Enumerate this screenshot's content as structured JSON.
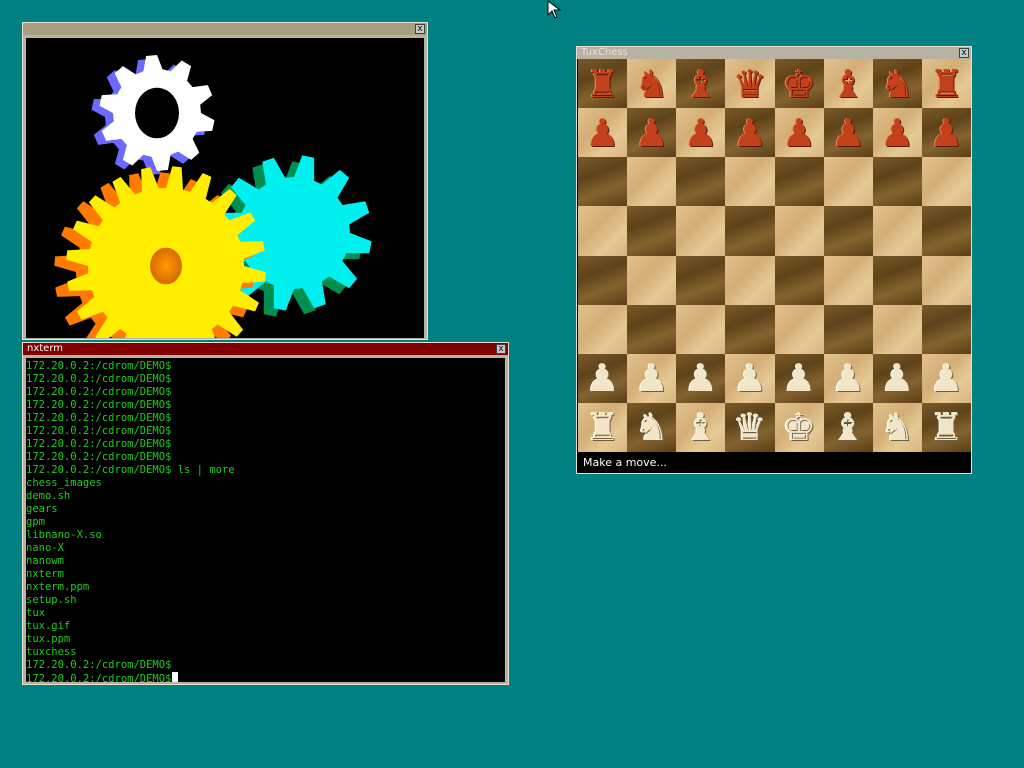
{
  "desktop": {
    "background_color": "#008080"
  },
  "windows": {
    "gears": {
      "title": "",
      "close_label": "x"
    },
    "terminal": {
      "title": "nxterm",
      "close_label": "x",
      "lines": [
        "172.20.0.2:/cdrom/DEMO$",
        "172.20.0.2:/cdrom/DEMO$",
        "172.20.0.2:/cdrom/DEMO$",
        "172.20.0.2:/cdrom/DEMO$",
        "172.20.0.2:/cdrom/DEMO$",
        "172.20.0.2:/cdrom/DEMO$",
        "172.20.0.2:/cdrom/DEMO$",
        "172.20.0.2:/cdrom/DEMO$",
        "172.20.0.2:/cdrom/DEMO$ ls | more",
        "chess_images",
        "demo.sh",
        "gears",
        "gpm",
        "libnano-X.so",
        "nano-X",
        "nanowm",
        "nxterm",
        "nxterm.ppm",
        "setup.sh",
        "tux",
        "tux.gif",
        "tux.ppm",
        "tuxchess",
        "172.20.0.2:/cdrom/DEMO$",
        "172.20.0.2:/cdrom/DEMO$"
      ],
      "text_color": "#1ccf1c"
    },
    "chess": {
      "title": "TuxChess",
      "close_label": "x",
      "status": "Make a move...",
      "board": [
        [
          "rook",
          "knight",
          "bishop",
          "queen",
          "king",
          "bishop",
          "knight",
          "rook"
        ],
        [
          "pawn",
          "pawn",
          "pawn",
          "pawn",
          "pawn",
          "pawn",
          "pawn",
          "pawn"
        ],
        [
          "",
          "",
          "",
          "",
          "",
          "",
          "",
          ""
        ],
        [
          "",
          "",
          "",
          "",
          "",
          "",
          "",
          ""
        ],
        [
          "",
          "",
          "",
          "",
          "",
          "",
          "",
          ""
        ],
        [
          "",
          "",
          "",
          "",
          "",
          "",
          "",
          ""
        ],
        [
          "pawn",
          "pawn",
          "pawn",
          "pawn",
          "pawn",
          "pawn",
          "pawn",
          "pawn"
        ],
        [
          "rook",
          "knight",
          "bishop",
          "queen",
          "king",
          "bishop",
          "knight",
          "rook"
        ]
      ],
      "top_side_color": "red",
      "bottom_side_color": "ivory",
      "piece_glyphs": {
        "rook": "♜",
        "knight": "♞",
        "bishop": "♝",
        "queen": "♛",
        "king": "♚",
        "pawn": "♟"
      }
    }
  },
  "pointer": {
    "icon": "mouse-pointer-icon"
  }
}
